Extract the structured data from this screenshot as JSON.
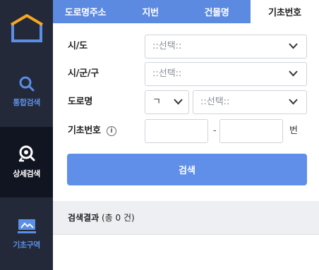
{
  "sidebar": {
    "items": [
      {
        "label": "통합검색",
        "icon": "search-icon"
      },
      {
        "label": "상세검색",
        "icon": "magnifier-location-icon"
      },
      {
        "label": "기초구역",
        "icon": "zone-monitor-icon"
      }
    ],
    "colors": {
      "background": "#232939",
      "active_background": "#111521",
      "accent": "#5b8fe5",
      "logo": "#f5a623"
    }
  },
  "tabs": [
    {
      "label": "도로명주소"
    },
    {
      "label": "지번"
    },
    {
      "label": "건물명"
    },
    {
      "label": "기초번호"
    }
  ],
  "form": {
    "sido": {
      "label": "시/도",
      "value": "::선택::"
    },
    "sigungu": {
      "label": "시/군/구",
      "value": "::선택::"
    },
    "road": {
      "label": "도로명",
      "initial_value": "ㄱ",
      "value": "::선택::"
    },
    "basic_number": {
      "label": "기초번호",
      "info": "i",
      "dash": "-",
      "unit": "번",
      "main_value": "",
      "sub_value": ""
    }
  },
  "search_button": {
    "label": "검색"
  },
  "result": {
    "title": "검색결과",
    "count_text": "(총 0 건)"
  }
}
